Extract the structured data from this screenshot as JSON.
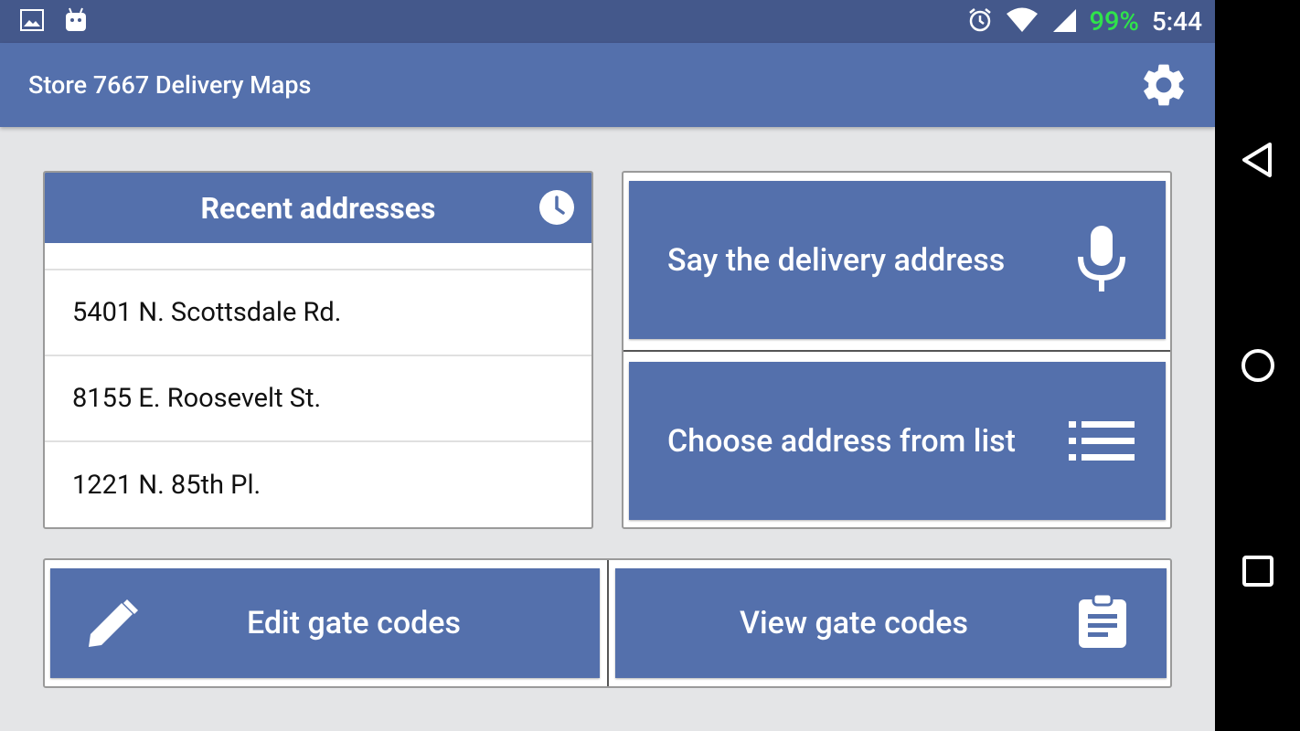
{
  "status_bar": {
    "battery": "99%",
    "time": "5:44",
    "icons": [
      "image-icon",
      "android-icon",
      "alarm-icon",
      "wifi-icon",
      "signal-icon"
    ]
  },
  "app_bar": {
    "title": "Store 7667 Delivery Maps",
    "settings_icon": "gear-icon"
  },
  "recent": {
    "header": "Recent addresses",
    "icon": "clock-icon",
    "addresses": [
      "5401 N. Scottsdale Rd.",
      "8155 E. Roosevelt St.",
      "1221 N. 85th Pl."
    ]
  },
  "actions": {
    "say_label": "Say the delivery address",
    "say_icon": "microphone-icon",
    "choose_label": "Choose address from list",
    "choose_icon": "list-icon"
  },
  "gates": {
    "edit_label": "Edit gate codes",
    "edit_icon": "pencil-icon",
    "view_label": "View gate codes",
    "view_icon": "clipboard-icon"
  },
  "colors": {
    "primary": "#5470ac",
    "status_bar": "#44588b",
    "background": "#e4e5e7",
    "battery_text": "#2fe34a"
  },
  "nav_bar": [
    "back-icon",
    "home-icon",
    "recents-icon"
  ]
}
